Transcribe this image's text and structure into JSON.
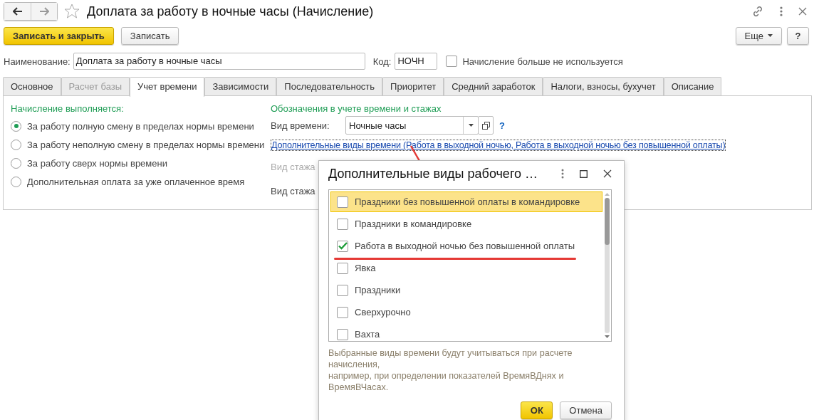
{
  "window": {
    "title": "Доплата за работу в ночные часы (Начисление)",
    "favorite": false
  },
  "toolbar": {
    "buttons": [
      {
        "label": "Записать и закрыть",
        "kind": "primary"
      },
      {
        "label": "Записать",
        "kind": "normal"
      }
    ],
    "more": "Еще",
    "help": "?"
  },
  "fields": {
    "name_label": "Наименование:",
    "name_value": "Доплата за работу в ночные часы",
    "code_label": "Код:",
    "code_value": "НОЧН",
    "unused": {
      "label": "Начисление больше не используется",
      "checked": false
    }
  },
  "tabs": [
    {
      "label": "Основное",
      "selected": false,
      "disabled": false
    },
    {
      "label": "Расчет базы",
      "selected": false,
      "disabled": true
    },
    {
      "label": "Учет времени",
      "selected": true,
      "disabled": false
    },
    {
      "label": "Зависимости",
      "selected": false,
      "disabled": false
    },
    {
      "label": "Последовательность",
      "selected": false,
      "disabled": false
    },
    {
      "label": "Приоритет",
      "selected": false,
      "disabled": false
    },
    {
      "label": "Средний заработок",
      "selected": false,
      "disabled": false
    },
    {
      "label": "Налоги, взносы, бухучет",
      "selected": false,
      "disabled": false
    },
    {
      "label": "Описание",
      "selected": false,
      "disabled": false
    }
  ],
  "accrual": {
    "heading": "Начисление выполняется:",
    "options": [
      {
        "label": "За работу полную смену в пределах нормы времени",
        "selected": true
      },
      {
        "label": "За работу неполную смену в пределах нормы времени",
        "selected": false
      },
      {
        "label": "За работу сверх нормы времени",
        "selected": false
      },
      {
        "label": "Дополнительная оплата за уже оплаченное время",
        "selected": false
      }
    ]
  },
  "time_marks": {
    "heading": "Обозначения в учете времени и стажах",
    "time_kind_label": "Вид времени:",
    "time_kind_value": "Ночные часы",
    "help": "?",
    "link": "Дополнительные виды времени (Работа в выходной ночью, Работа в выходной ночью без повышенной оплаты)",
    "seniority": [
      {
        "label": "Вид стажа",
        "disabled": true
      },
      {
        "label": "Вид стажа",
        "disabled": false
      }
    ]
  },
  "dialog": {
    "title": "Дополнительные виды рабочего …",
    "items": [
      {
        "label": "Праздники без повышенной оплаты в командировке",
        "checked": false,
        "selected": true
      },
      {
        "label": "Праздники в командировке",
        "checked": false,
        "selected": false
      },
      {
        "label": "Работа в выходной ночью без повышенной оплаты",
        "checked": true,
        "selected": false
      },
      {
        "label": "Явка",
        "checked": false,
        "selected": false
      },
      {
        "label": "Праздники",
        "checked": false,
        "selected": false
      },
      {
        "label": "Сверхурочно",
        "checked": false,
        "selected": false
      },
      {
        "label": "Вахта",
        "checked": false,
        "selected": false
      }
    ],
    "note_lines": [
      "Выбранные виды времени будут учитываться при расчете",
      "начисления,",
      "например, при определении показателей ВремяВДнях и",
      "ВремяВЧасах."
    ],
    "ok": "ОК",
    "cancel": "Отмена"
  }
}
